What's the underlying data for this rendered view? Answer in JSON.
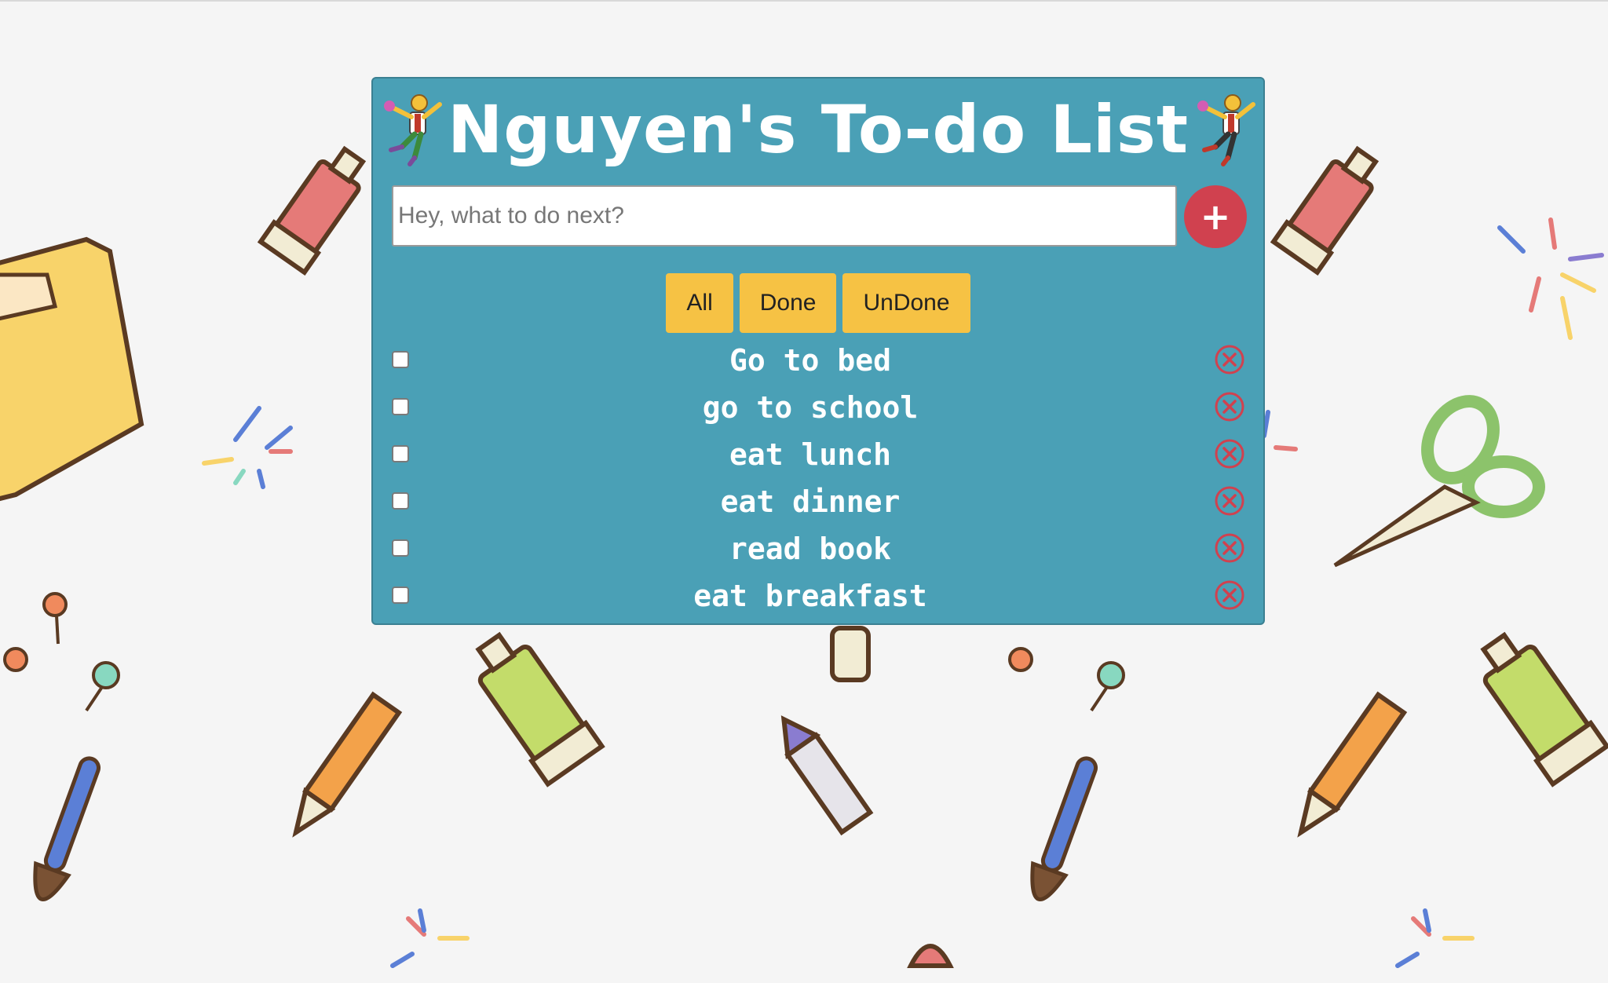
{
  "app": {
    "title": "Nguyen's To-do List"
  },
  "input": {
    "placeholder": "Hey, what to do next?",
    "value": ""
  },
  "add_button": {
    "label": "+"
  },
  "filters": [
    {
      "label": "All"
    },
    {
      "label": "Done"
    },
    {
      "label": "UnDone"
    }
  ],
  "todos": [
    {
      "text": "Go to bed",
      "done": false
    },
    {
      "text": "go to school",
      "done": false
    },
    {
      "text": "eat lunch",
      "done": false
    },
    {
      "text": "eat dinner",
      "done": false
    },
    {
      "text": "read book",
      "done": false
    },
    {
      "text": "eat breakfast",
      "done": false
    }
  ],
  "icons": {
    "title_left": "handball-player-emoji",
    "title_right": "handball-player-emoji",
    "delete": "circle-x-icon"
  },
  "colors": {
    "card": "#4aa0b6",
    "add_button": "#d0414f",
    "filter_button": "#f6c244",
    "delete_icon": "#d0414f",
    "text": "#ffffff"
  }
}
